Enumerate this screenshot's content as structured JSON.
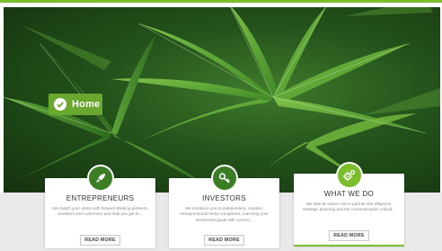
{
  "hero": {
    "badge_label": "Home"
  },
  "cards": [
    {
      "title": "ENTREPRENEURS",
      "description": "We match your vision with forward-thinking partners, investors and customers and help you get to...",
      "button": "READ MORE",
      "icon": "rocket-icon"
    },
    {
      "title": "INVESTORS",
      "description": "We introduce you to independent, creative, entrepreneurial hemp companies, matching your investment goals with owners...",
      "button": "READ MORE",
      "icon": "key-icon"
    },
    {
      "title": "WHAT WE DO",
      "description": "We take an active role in partner due diligence, strategic planning and the communication critical...",
      "button": "READ MORE",
      "icon": "gears-icon"
    }
  ],
  "colors": {
    "accent_green": "#7cbd2c",
    "dark_green": "#3c7e23",
    "badge_green": "#6aa72f"
  }
}
